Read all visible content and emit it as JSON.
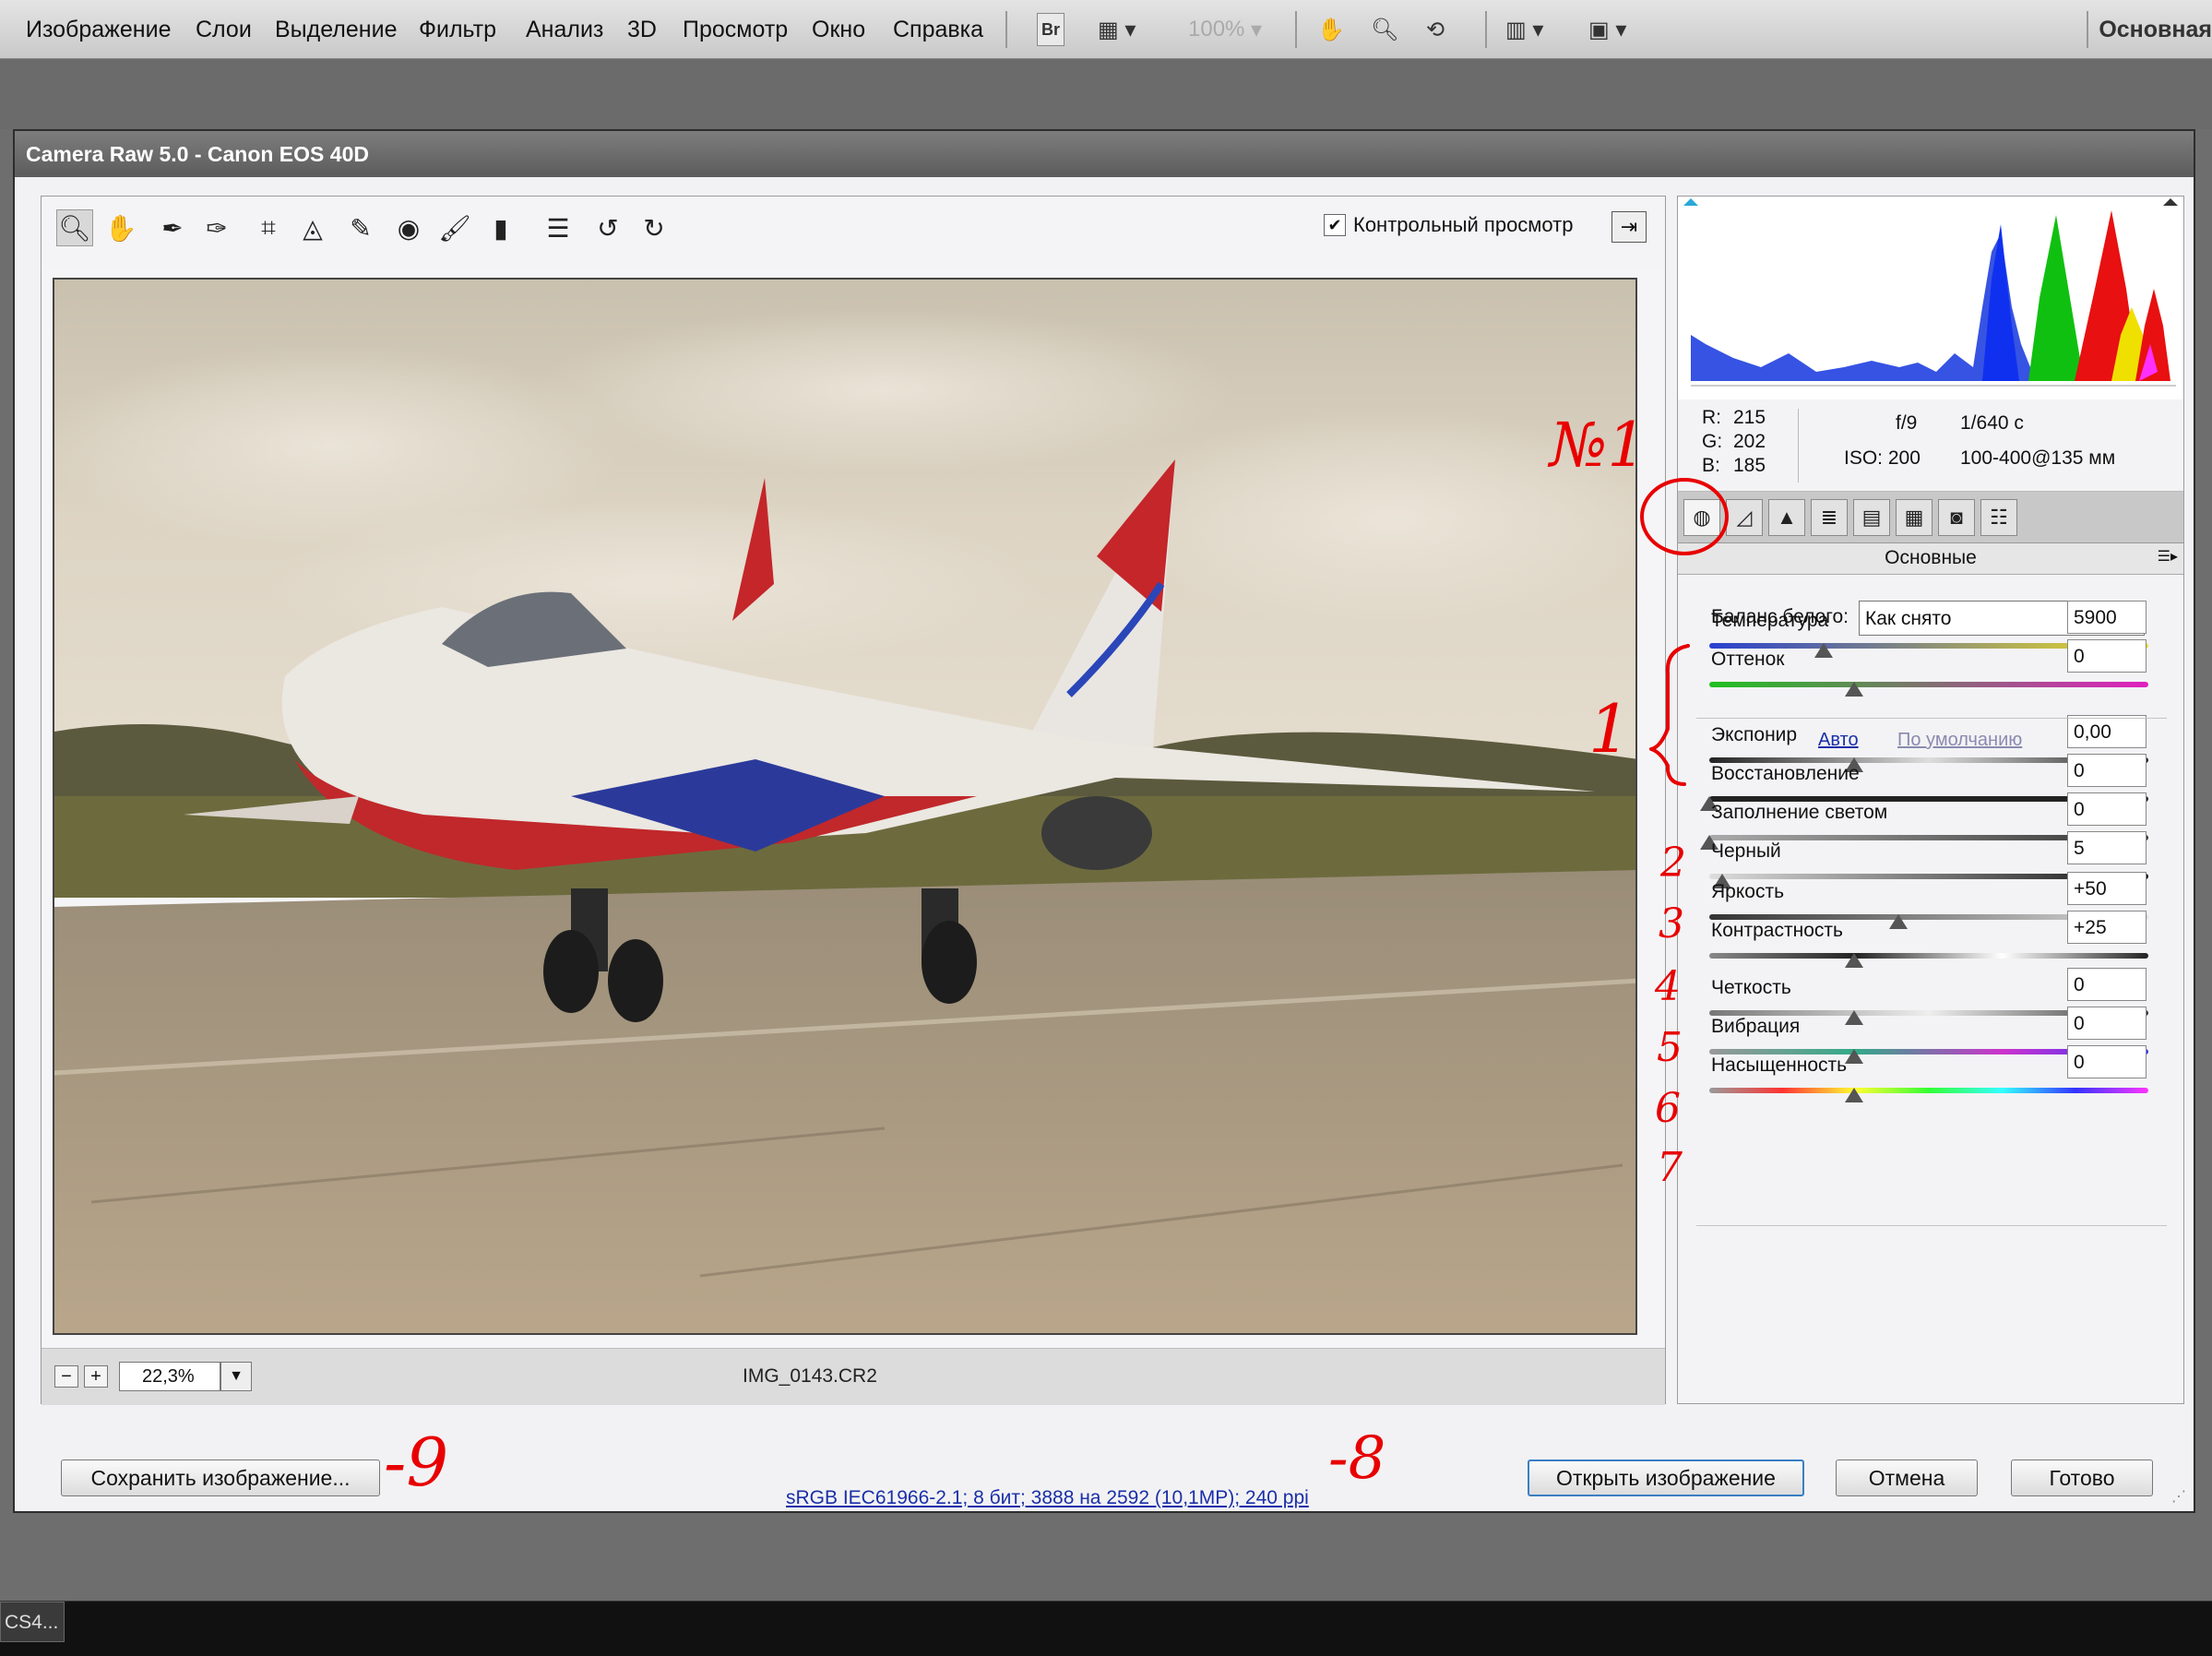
{
  "menubar": {
    "items": [
      "Изображение",
      "Слои",
      "Выделение",
      "Фильтр",
      "Анализ",
      "3D",
      "Просмотр",
      "Окно",
      "Справка"
    ],
    "bridge": "Br",
    "zoom": "100%",
    "workspace": "Основная"
  },
  "dialog": {
    "title": "Camera Raw 5.0  -  Canon EOS 40D",
    "preview_label": "Контрольный просмотр",
    "zoom_value": "22,3%",
    "filename": "IMG_0143.CR2"
  },
  "readout": {
    "r_label": "R:",
    "r": "215",
    "g_label": "G:",
    "g": "202",
    "b_label": "B:",
    "b": "185",
    "aperture": "f/9",
    "shutter": "1/640 c",
    "iso": "ISO: 200",
    "lens": "100-400@135 мм"
  },
  "panel": {
    "title": "Основные",
    "wb_label": "Баланс белого:",
    "wb_value": "Как снято",
    "auto_link": "Авто",
    "default_link": "По умолчанию",
    "sliders": [
      {
        "label": "Температура",
        "value": "5900",
        "position": 0.26
      },
      {
        "label": "Оттенок",
        "value": "0",
        "position": 0.33
      },
      {
        "label": "Экспонир",
        "value": "0,00",
        "position": 0.33
      },
      {
        "label": "Восстановление",
        "value": "0",
        "position": 0.0
      },
      {
        "label": "Заполнение светом",
        "value": "0",
        "position": 0.0
      },
      {
        "label": "Черный",
        "value": "5",
        "position": 0.03
      },
      {
        "label": "Яркость",
        "value": "+50",
        "position": 0.43
      },
      {
        "label": "Контрастность",
        "value": "+25",
        "position": 0.33
      },
      {
        "label": "Четкость",
        "value": "0",
        "position": 0.33
      },
      {
        "label": "Вибрация",
        "value": "0",
        "position": 0.33
      },
      {
        "label": "Насыщенность",
        "value": "0",
        "position": 0.33
      }
    ]
  },
  "buttons": {
    "save": "Сохранить изображение...",
    "open": "Открыть изображение",
    "cancel": "Отмена",
    "done": "Готово",
    "info": "sRGB IEC61966-2.1; 8 бит; 3888 на 2592 (10,1МР); 240 ppi"
  },
  "annotations": {
    "n1": "№1",
    "one": "1",
    "two": "2",
    "three": "3",
    "four": "4",
    "five": "5",
    "six": "6",
    "seven": "7",
    "eight": "-8",
    "nine": "-9"
  },
  "taskbar": {
    "item": "CS4..."
  },
  "colors": {
    "accent": "#3a7fc4",
    "annotation": "#e80000",
    "link": "#1a2fa8"
  }
}
